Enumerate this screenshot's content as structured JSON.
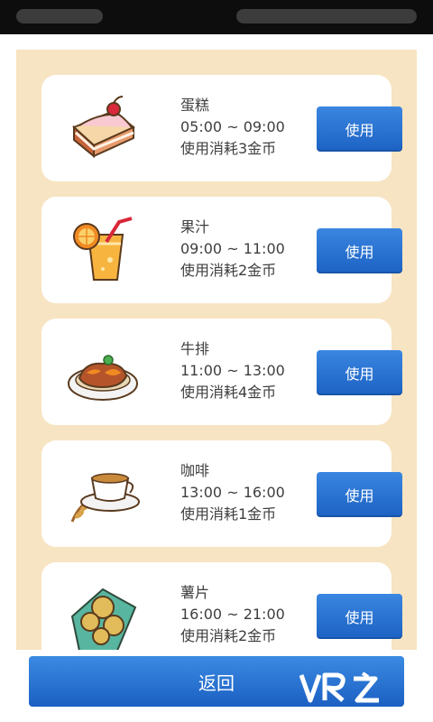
{
  "status_bar": {},
  "items": [
    {
      "name": "蛋糕",
      "time": "05:00 ~ 09:00",
      "cost": "使用消耗3金币",
      "button": "使用",
      "icon": "cake-icon"
    },
    {
      "name": "果汁",
      "time": "09:00 ~ 11:00",
      "cost": "使用消耗2金币",
      "button": "使用",
      "icon": "juice-icon"
    },
    {
      "name": "牛排",
      "time": "11:00 ~ 13:00",
      "cost": "使用消耗4金币",
      "button": "使用",
      "icon": "steak-icon"
    },
    {
      "name": "咖啡",
      "time": "13:00 ~ 16:00",
      "cost": "使用消耗1金币",
      "button": "使用",
      "icon": "coffee-icon"
    },
    {
      "name": "薯片",
      "time": "16:00 ~ 21:00",
      "cost": "使用消耗2金币",
      "button": "使用",
      "icon": "chips-icon"
    }
  ],
  "footer": {
    "back_label": "返回"
  },
  "watermark": {
    "text": "VRZ"
  },
  "colors": {
    "panel": "#f7e4c2",
    "button": "#1f67c8",
    "card": "#ffffff"
  }
}
